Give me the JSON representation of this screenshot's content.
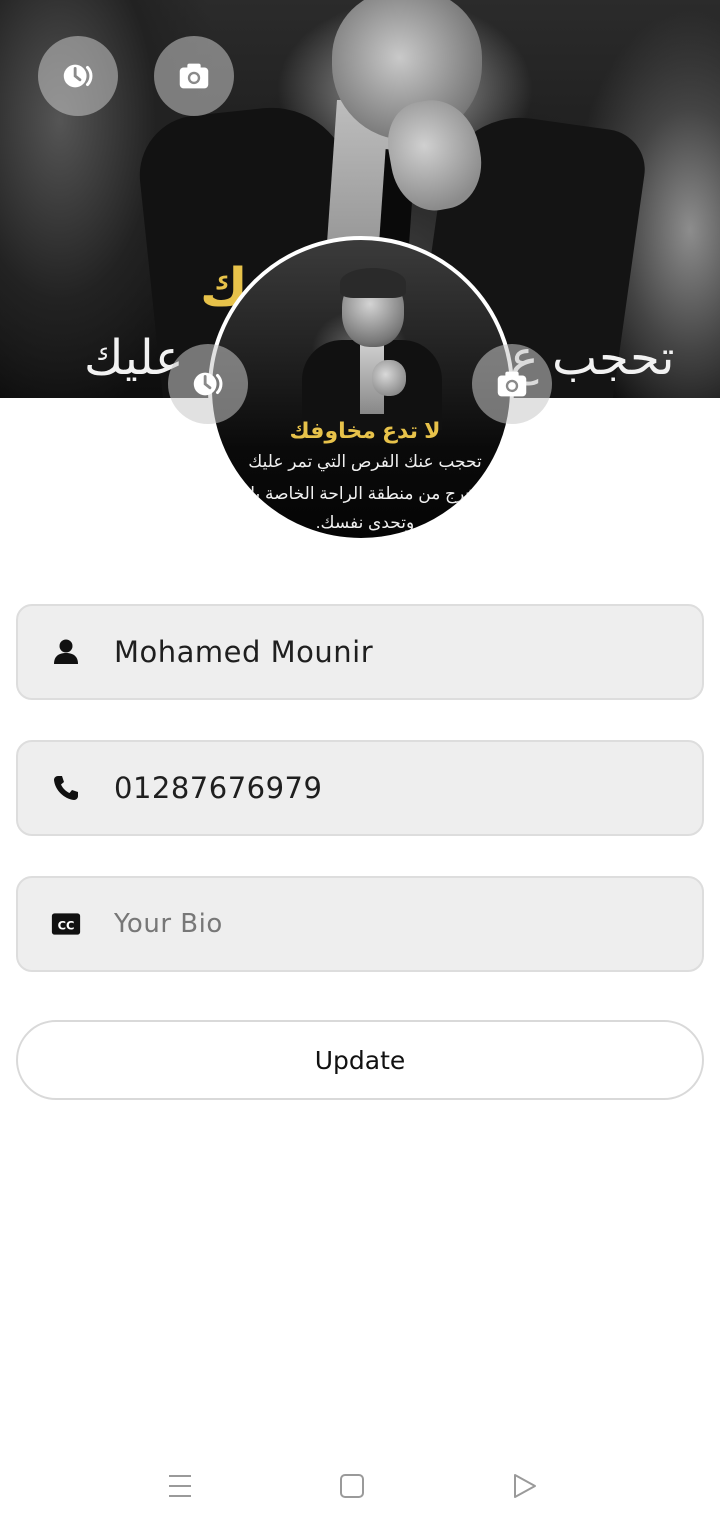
{
  "cover": {
    "image": "cover-photo",
    "overlay_text_line1": "لا ... ك",
    "overlay_text_line2_left": "مر عليك",
    "overlay_text_line2_right": "تحجب ع"
  },
  "cover_buttons": {
    "history_icon": "history-icon",
    "camera_icon": "camera-icon"
  },
  "avatar": {
    "image": "profile-photo",
    "line1": "لا تدع مخاوفك",
    "line2": "تحجب عنك الفرص التي تمر عليك",
    "line3": "وأخرج من منطقة الراحة الخاصة بك",
    "line4": "وتحدى نفسك.",
    "history_icon": "history-icon",
    "camera_icon": "camera-icon"
  },
  "form": {
    "name": {
      "icon": "person-icon",
      "value": "Mohamed Mounir"
    },
    "phone": {
      "icon": "phone-icon",
      "value": "01287676979"
    },
    "bio": {
      "icon": "closed-caption-icon",
      "value": "",
      "placeholder": "Your Bio"
    },
    "update_label": "Update"
  },
  "nav": {
    "menu_icon": "menu-icon",
    "home_icon": "home-square-icon",
    "back_icon": "back-triangle-icon"
  },
  "colors": {
    "field_bg": "#eeeeee",
    "field_border": "#dddddd",
    "accent_yellow": "#e7c24a",
    "icon_dark": "#111111"
  }
}
